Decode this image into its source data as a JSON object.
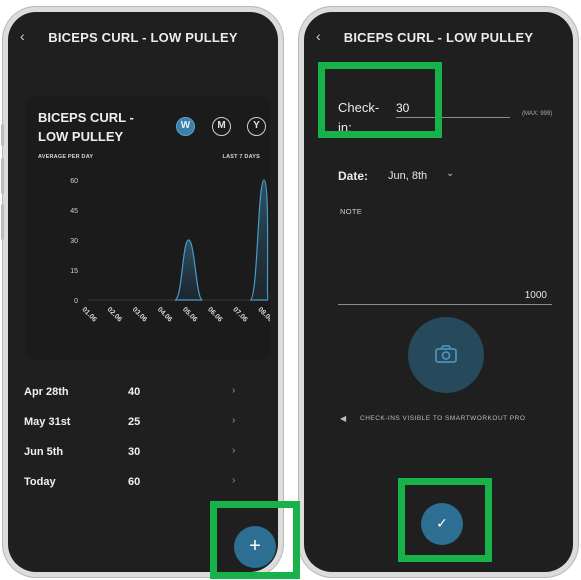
{
  "left_screen": {
    "header": {
      "back": "‹",
      "title": "BICEPS CURL -  LOW PULLEY"
    },
    "card": {
      "title": "BICEPS CURL - LOW PULLEY",
      "periods": [
        "W",
        "M",
        "Y"
      ],
      "active_period": "W",
      "caption_left": "AVERAGE PER DAY",
      "caption_right": "LAST 7 DAYS"
    },
    "history": [
      {
        "date": "Apr 28th",
        "value": "40"
      },
      {
        "date": "May 31st",
        "value": "25"
      },
      {
        "date": "Jun 5th",
        "value": "30"
      },
      {
        "date": "Today",
        "value": "60"
      }
    ],
    "fab": "+"
  },
  "right_screen": {
    "header": {
      "back": "‹",
      "title": "BICEPS CURL -  LOW PULLEY"
    },
    "checkin": {
      "label": "Check-in:",
      "value": "30",
      "max": "(MAX: 999)"
    },
    "date": {
      "label": "Date:",
      "value": "Jun, 8th"
    },
    "note": {
      "label": "NOTE",
      "count": "1000"
    },
    "visibility_text": "CHECK-INS VISIBLE TO SMARTWORKOUT PRO",
    "confirm": "✓"
  },
  "colors": {
    "accent": "#2d6f92",
    "highlight": "#17b24a",
    "background": "#1f1f20"
  },
  "chart_data": {
    "type": "area",
    "categories": [
      "01.06",
      "02.06",
      "03.06",
      "04.06",
      "05.06",
      "06.06",
      "07.06",
      "08.06"
    ],
    "values": [
      0,
      0,
      0,
      0,
      30,
      0,
      0,
      60
    ],
    "yticks": [
      0,
      15,
      30,
      45,
      60
    ],
    "ylim": [
      0,
      60
    ]
  }
}
